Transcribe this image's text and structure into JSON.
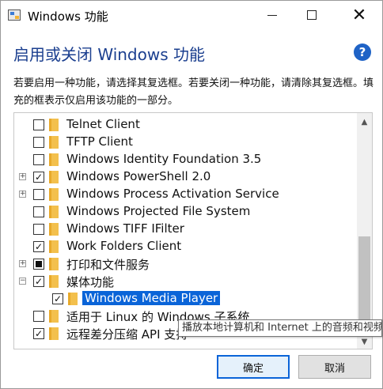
{
  "window": {
    "title": "Windows 功能",
    "minimize_label": "",
    "maximize_label": "",
    "close_label": "✕"
  },
  "header": {
    "heading": "启用或关闭 Windows 功能",
    "help_label": "?",
    "description": "若要启用一种功能，请选择其复选框。若要关闭一种功能，请清除其复选框。填充的框表示仅启用该功能的一部分。"
  },
  "features": [
    {
      "label": "Telnet Client",
      "state": "unchecked",
      "expandable": false,
      "level": 0
    },
    {
      "label": "TFTP Client",
      "state": "unchecked",
      "expandable": false,
      "level": 0
    },
    {
      "label": "Windows Identity Foundation 3.5",
      "state": "unchecked",
      "expandable": false,
      "level": 0
    },
    {
      "label": "Windows PowerShell 2.0",
      "state": "checked",
      "expandable": true,
      "expander": "+",
      "level": 0
    },
    {
      "label": "Windows Process Activation Service",
      "state": "unchecked",
      "expandable": true,
      "expander": "+",
      "level": 0
    },
    {
      "label": "Windows Projected File System",
      "state": "unchecked",
      "expandable": false,
      "level": 0
    },
    {
      "label": "Windows TIFF IFilter",
      "state": "unchecked",
      "expandable": false,
      "level": 0
    },
    {
      "label": "Work Folders Client",
      "state": "checked",
      "expandable": false,
      "level": 0
    },
    {
      "label": "打印和文件服务",
      "state": "partial",
      "expandable": true,
      "expander": "+",
      "level": 0
    },
    {
      "label": "媒体功能",
      "state": "checked",
      "expandable": true,
      "expander": "−",
      "level": 0
    },
    {
      "label": "Windows Media Player",
      "state": "checked",
      "expandable": false,
      "level": 1,
      "selected": true
    },
    {
      "label": "适用于 Linux 的 Windows 子系统",
      "state": "unchecked",
      "expandable": false,
      "level": 0
    },
    {
      "label": "远程差分压缩 API 支持",
      "state": "checked",
      "expandable": false,
      "level": 0
    }
  ],
  "tooltip": "播放本地计算机和 Internet 上的音频和视频文件",
  "buttons": {
    "ok": "确定",
    "cancel": "取消"
  },
  "colors": {
    "heading": "#1b3f8f",
    "selection": "#0a64d8",
    "help_icon": "#1f63c6",
    "folder": "#f3c04d"
  }
}
